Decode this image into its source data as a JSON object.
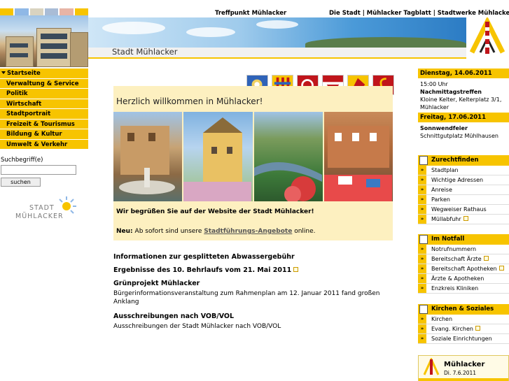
{
  "header": {
    "treffpunkt": "Treffpunkt Mühlacker",
    "top_links": "Die Stadt | Mühlacker Tagblatt | Stadtwerke Mühlacker",
    "site_title": "Stadt Mühlacker"
  },
  "colors": {
    "accent": "#f7c400",
    "strip": [
      "#f7c400",
      "#8fb8e6",
      "#d9d3c0",
      "#a9bcd6",
      "#e7b4a6",
      "#f7c400"
    ]
  },
  "nav": {
    "items": [
      {
        "label": "Startseite"
      },
      {
        "label": "Verwaltung & Service"
      },
      {
        "label": "Politik"
      },
      {
        "label": "Wirtschaft"
      },
      {
        "label": "Stadtportrait"
      },
      {
        "label": "Freizeit & Tourismus"
      },
      {
        "label": "Bildung & Kultur"
      },
      {
        "label": "Umwelt & Verkehr"
      }
    ]
  },
  "search": {
    "label": "Suchbegriff(e)",
    "value": "",
    "button": "suchen"
  },
  "logo": {
    "line1": "STADT",
    "line2": "MÜHLACKER"
  },
  "welcome": {
    "title": "Herzlich willkommen in Mühlacker!",
    "greeting": "Wir begrüßen Sie auf der Website der Stadt Mühlacker!",
    "news_prefix": "Neu:",
    "news_text": "Ab sofort sind unsere",
    "news_link": "Stadtführungs-Angebote",
    "news_suffix": "online."
  },
  "news": [
    {
      "title": "Informationen zur gesplitteten Abwassergebühr",
      "sub": ""
    },
    {
      "title": "Ergebnisse des 10. Behrlaufs vom 21. Mai 2011",
      "sub": ""
    },
    {
      "title": "Grünprojekt Mühlacker",
      "sub": "Bürgerinformationsveranstaltung zum Rahmenplan am 12. Januar 2011 fand großen Anklang"
    },
    {
      "title": "Ausschreibungen nach VOB/VOL",
      "sub": "Ausschreibungen der Stadt Mühlacker nach VOB/VOL"
    }
  ],
  "events": [
    {
      "date": "Dienstag, 14.06.2011",
      "time": "15:00 Uhr",
      "name": "Nachmittagstreffen",
      "place": "Kloine Kelter, Kelterplatz 3/1, Mühlacker"
    },
    {
      "date": "Freitag, 17.06.2011",
      "time": "",
      "name": "Sonnwendfeier",
      "place": "Schnittgutplatz Mühlhausen"
    }
  ],
  "boxes": [
    {
      "title": "Zurechtfinden",
      "items": [
        "Stadtplan",
        "Wichtige Adressen",
        "Anreise",
        "Parken",
        "Wegweiser Rathaus",
        "Müllabfuhr"
      ]
    },
    {
      "title": "Im Notfall",
      "items": [
        "Notrufnummern",
        "Bereitschaft Ärzte",
        "Bereitschaft Apotheken",
        "Ärzte & Apotheken",
        "Enzkreis Kliniken"
      ]
    },
    {
      "title": "Kirchen & Soziales",
      "items": [
        "Kirchen",
        "Evang. Kirchen",
        "Soziale Einrichtungen"
      ]
    }
  ],
  "weather": {
    "title": "Mühlacker",
    "date": "Di. 7.6.2011"
  }
}
